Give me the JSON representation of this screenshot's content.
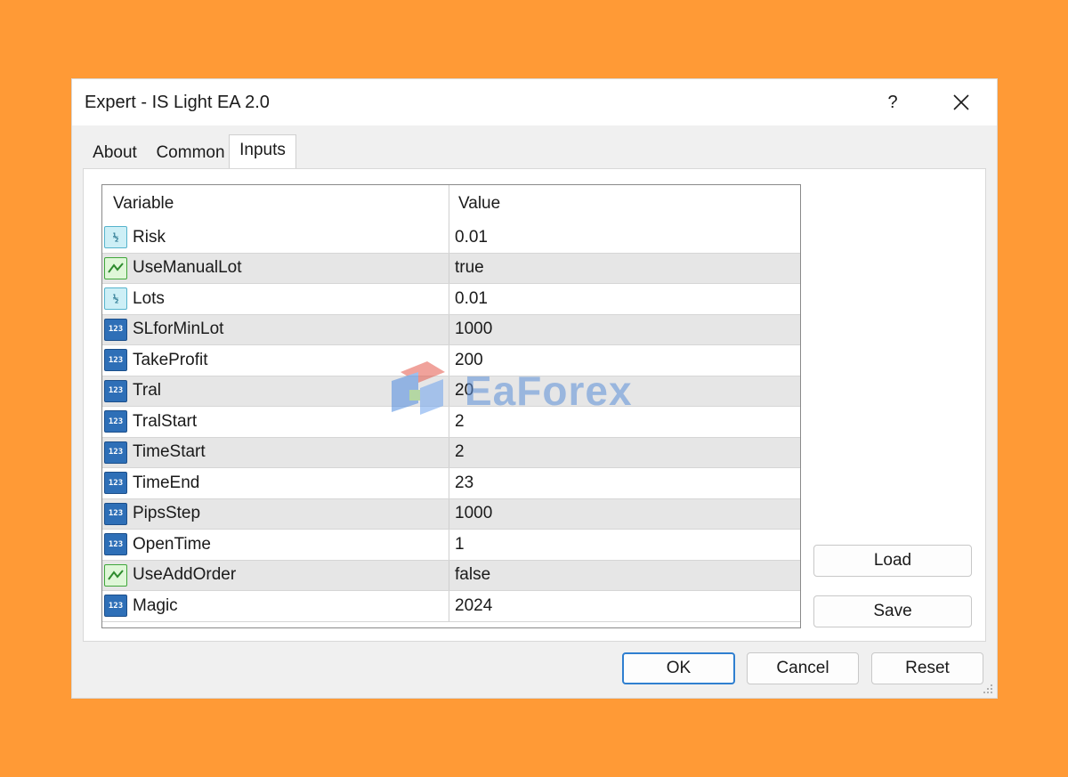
{
  "window": {
    "title": "Expert - IS Light EA 2.0",
    "help_label": "?",
    "close_label": "✕"
  },
  "tabs": [
    {
      "label": "About",
      "active": false
    },
    {
      "label": "Common",
      "active": false
    },
    {
      "label": "Inputs",
      "active": true
    }
  ],
  "grid": {
    "headers": {
      "variable": "Variable",
      "value": "Value"
    },
    "rows": [
      {
        "type": "double",
        "icon": "double-type-icon",
        "variable": "Risk",
        "value": "0.01"
      },
      {
        "type": "bool",
        "icon": "bool-type-icon",
        "variable": "UseManualLot",
        "value": "true"
      },
      {
        "type": "double",
        "icon": "double-type-icon",
        "variable": "Lots",
        "value": "0.01"
      },
      {
        "type": "int",
        "icon": "int-type-icon",
        "variable": "SLforMinLot",
        "value": "1000"
      },
      {
        "type": "int",
        "icon": "int-type-icon",
        "variable": "TakeProfit",
        "value": "200"
      },
      {
        "type": "int",
        "icon": "int-type-icon",
        "variable": "Tral",
        "value": "20"
      },
      {
        "type": "int",
        "icon": "int-type-icon",
        "variable": "TralStart",
        "value": "2"
      },
      {
        "type": "int",
        "icon": "int-type-icon",
        "variable": "TimeStart",
        "value": "2"
      },
      {
        "type": "int",
        "icon": "int-type-icon",
        "variable": "TimeEnd",
        "value": "23"
      },
      {
        "type": "int",
        "icon": "int-type-icon",
        "variable": "PipsStep",
        "value": "1000"
      },
      {
        "type": "int",
        "icon": "int-type-icon",
        "variable": "OpenTime",
        "value": "1"
      },
      {
        "type": "bool",
        "icon": "bool-type-icon",
        "variable": "UseAddOrder",
        "value": "false"
      },
      {
        "type": "int",
        "icon": "int-type-icon",
        "variable": "Magic",
        "value": "2024"
      }
    ]
  },
  "side_buttons": {
    "load": "Load",
    "save": "Save"
  },
  "footer_buttons": {
    "ok": "OK",
    "cancel": "Cancel",
    "reset": "Reset"
  },
  "icon_glyphs": {
    "double": "½",
    "int": "123"
  },
  "watermark": {
    "text": "EaForex"
  },
  "colors": {
    "page_background": "#FF9A36",
    "dialog_background": "#F0F0F0",
    "alt_row": "#E6E6E6",
    "default_button_border": "#2F7FD0",
    "int_icon": "#2E6FB7",
    "double_icon": "#CDEFF6",
    "bool_icon": "#DFF7D8"
  }
}
